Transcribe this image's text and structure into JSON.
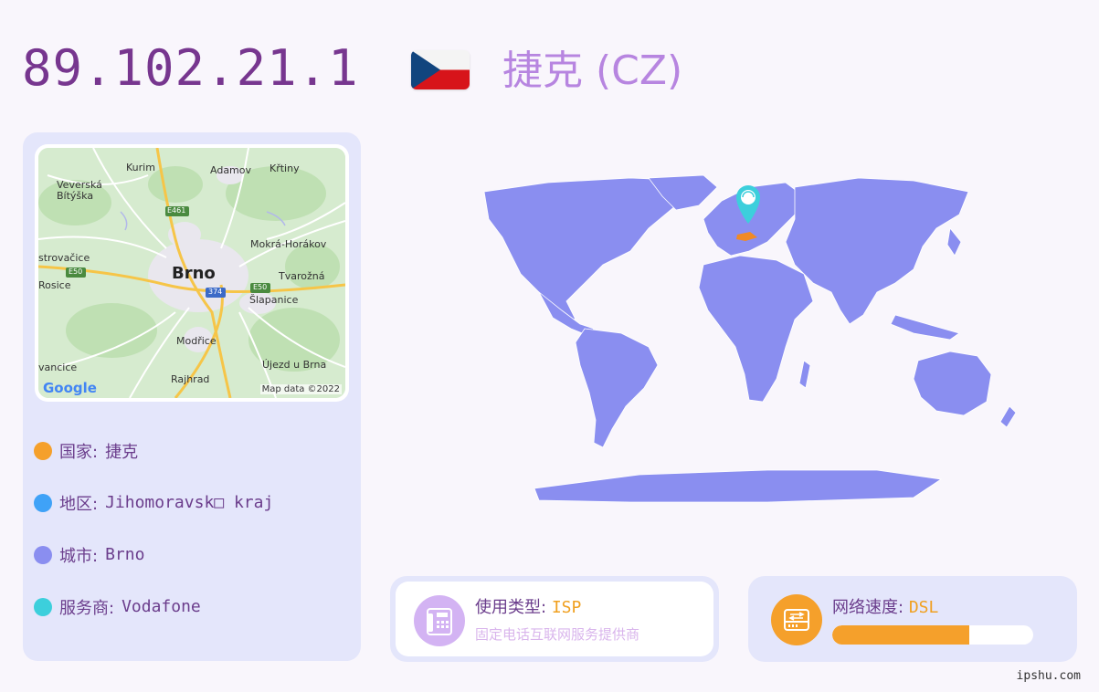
{
  "ip": "89.102.21.1",
  "country_title": "捷克 (CZ)",
  "map": {
    "place_labels": [
      "Kurim",
      "Adamov",
      "Křtiny",
      "Veverská\nBítýška",
      "Mokrá-Horákov",
      "Brno",
      "Tvarožná",
      "strovačice",
      "Rosice",
      "Šlapanice",
      "Modřice",
      "Újezd u Brna",
      "vancice",
      "Rajhrad"
    ],
    "road_labels": [
      "E461",
      "E50",
      "374",
      "E50"
    ],
    "google_logo": "Google",
    "attribution": "Map data ©2022"
  },
  "info": [
    {
      "label": "国家:",
      "value": "捷克",
      "color": "#f5a02b"
    },
    {
      "label": "地区:",
      "value": "Jihomoravsk□ kraj",
      "color": "#3fa2f7"
    },
    {
      "label": "城市:",
      "value": "Brno",
      "color": "#8a8ef0"
    },
    {
      "label": "服务商:",
      "value": "Vodafone",
      "color": "#3ccfdc"
    }
  ],
  "usage": {
    "label": "使用类型:",
    "value": "ISP",
    "desc": "固定电话互联网服务提供商",
    "icon": "phone-fax-icon"
  },
  "speed": {
    "label": "网络速度:",
    "value": "DSL",
    "level": 0.68,
    "icon": "network-drive-icon"
  },
  "footer": "ipshu.com",
  "colors": {
    "accent": "#77368f",
    "continent": "#8a8ef0",
    "pin": "#3ccfdc",
    "highlight": "#f08a24"
  }
}
